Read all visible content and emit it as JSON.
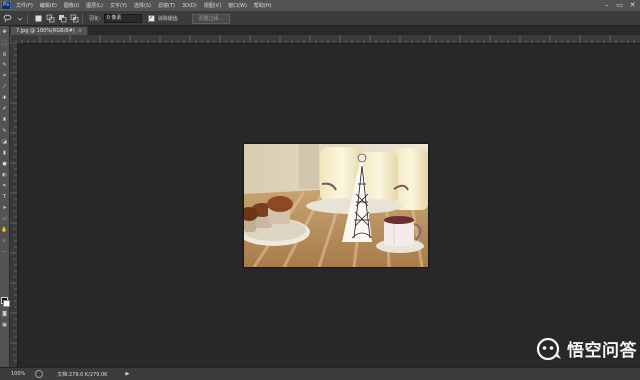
{
  "app": {
    "logo_text": "Ps"
  },
  "menu": {
    "items": [
      "文件(F)",
      "编辑(E)",
      "图像(I)",
      "图层(L)",
      "文字(Y)",
      "选择(S)",
      "滤镜(T)",
      "3D(D)",
      "视图(V)",
      "窗口(W)",
      "帮助(H)"
    ]
  },
  "window_controls": {
    "minimize": "–",
    "restore": "▭",
    "close": "✕"
  },
  "options": {
    "feather_label": "羽化:",
    "feather_value": "0 像素",
    "antialias_checked": "✓",
    "antialias_label": "消除锯齿",
    "refine_button": "调整边缘..."
  },
  "document": {
    "tab_title": "7.jpg @ 100%(RGB/8#)",
    "tab_close": "×"
  },
  "status": {
    "zoom": "100%",
    "doc_info": "文档:279.0 K/279.0K",
    "arrow": "▶"
  },
  "watermark": {
    "text": "悟空问答"
  },
  "colors": {
    "foreground": "#111111",
    "background": "#ffffff",
    "workspace": "#282828"
  }
}
